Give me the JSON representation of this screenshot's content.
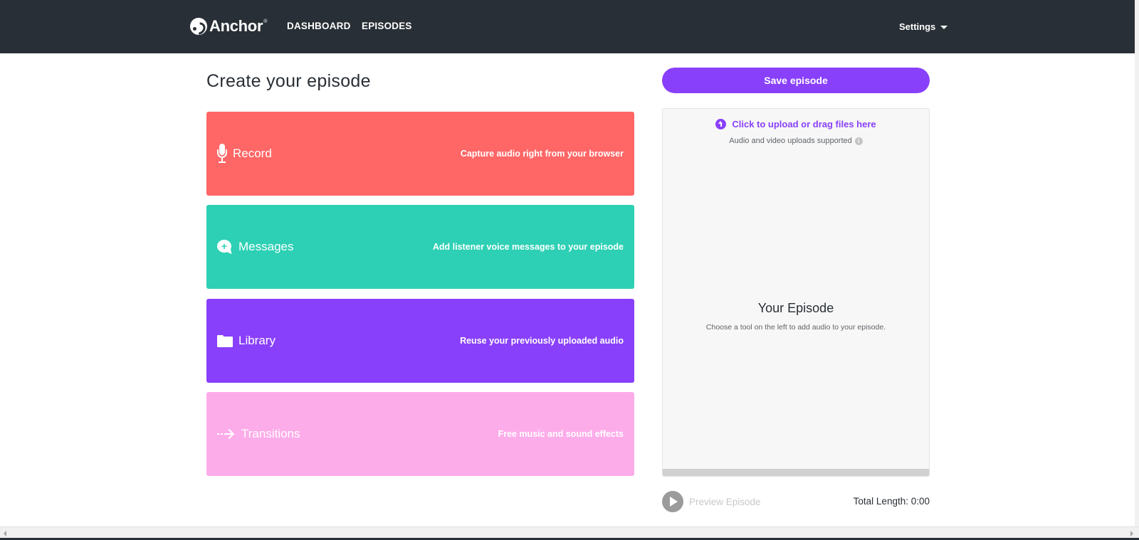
{
  "nav": {
    "brand": "Anchor",
    "brand_mark": "®",
    "links": [
      {
        "label": "DASHBOARD"
      },
      {
        "label": "EPISODES"
      }
    ],
    "settings_label": "Settings"
  },
  "main": {
    "title": "Create your episode",
    "tools": [
      {
        "label": "Record",
        "description": "Capture audio right from your browser",
        "icon": "microphone-icon",
        "color": "#ff6666"
      },
      {
        "label": "Messages",
        "description": "Add listener voice messages to your episode",
        "icon": "chat-bubble-icon",
        "color": "#2dd0b4"
      },
      {
        "label": "Library",
        "description": "Reuse your previously uploaded audio",
        "icon": "folder-icon",
        "color": "#8940fa"
      },
      {
        "label": "Transitions",
        "description": "Free music and sound effects",
        "icon": "arrow-right-icon",
        "color": "#fdacea"
      }
    ]
  },
  "episode": {
    "save_label": "Save episode",
    "upload_label": "Click to upload or drag files here",
    "upload_note": "Audio and video uploads supported",
    "title": "Your Episode",
    "hint": "Choose a tool on the left to add audio to your episode.",
    "preview_label": "Preview Episode",
    "total_length_label": "Total Length: 0:00"
  },
  "colors": {
    "navbar": "#292f36",
    "accent": "#8940fa"
  }
}
